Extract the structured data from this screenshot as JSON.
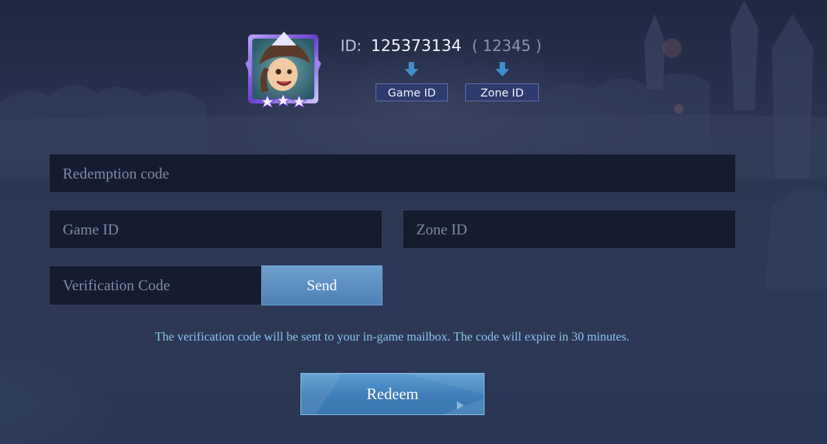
{
  "player": {
    "id_label": "ID:",
    "game_id": "125373134",
    "zone_display": "( 12345 )"
  },
  "annotations": {
    "game_id_tag": "Game ID",
    "zone_id_tag": "Zone ID",
    "arrow_color": "#3f8fcb"
  },
  "form": {
    "redemption_placeholder": "Redemption code",
    "game_id_placeholder": "Game ID",
    "zone_id_placeholder": "Zone ID",
    "verification_placeholder": "Verification Code",
    "send_label": "Send",
    "hint": "The verification code will be sent to your in-game mailbox. The code will expire in 30 minutes.",
    "redeem_label": "Redeem"
  },
  "theme": {
    "accent": "#4f80b5",
    "hint_color": "#88c6ee",
    "field_bg": "#141a2c"
  }
}
